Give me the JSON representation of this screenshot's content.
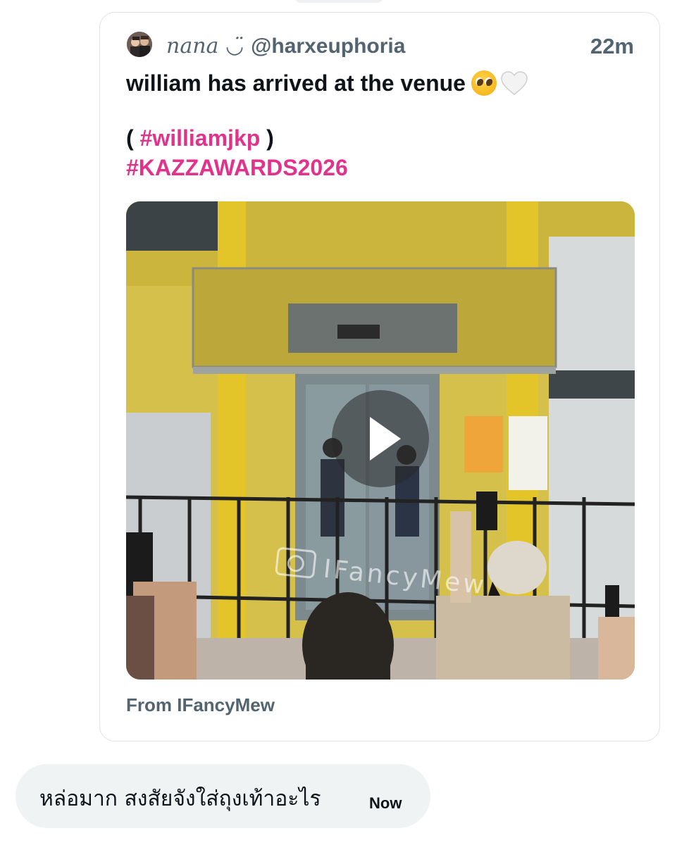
{
  "quoted_tweet": {
    "display_name": "nana ◡̈",
    "handle": "@harxeuphoria",
    "timestamp": "22m",
    "text_line1": "william has arrived at the venue",
    "hashtag_line_open": "( ",
    "hashtag1": "#williamjkp",
    "hashtag_line_close": " )",
    "hashtag2": "#KAZZAWARDS2026",
    "media_watermark": "IFancyMew",
    "media_source": "From IFancyMew",
    "hashtag_color": "#e0338c"
  },
  "message": {
    "text": "หล่อมาก สงสัยจังใส่ถุงเท้าอะไร",
    "time": "Now"
  },
  "icons": [
    "avatar-image",
    "pleading-face-emoji",
    "white-heart-emoji",
    "play-icon",
    "camera-icon"
  ]
}
